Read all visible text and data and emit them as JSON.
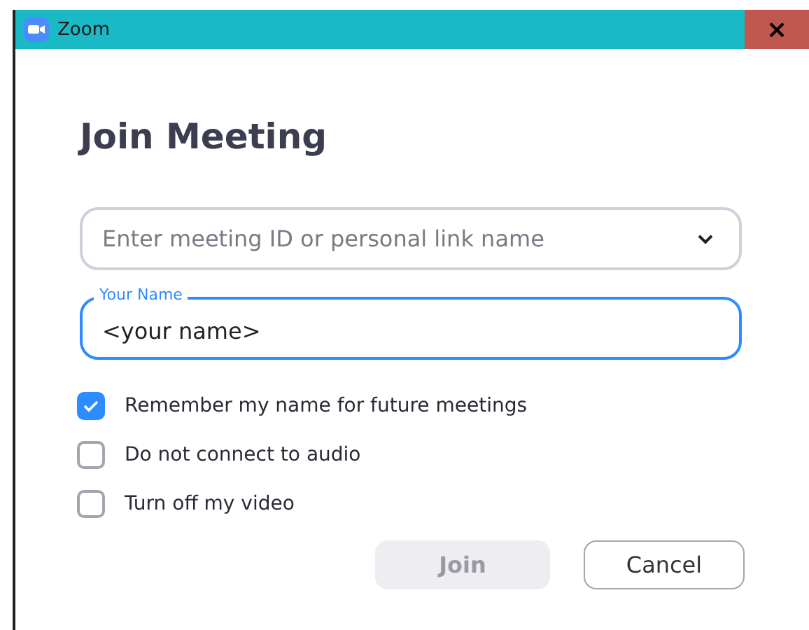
{
  "window": {
    "title": "Zoom",
    "close": "×"
  },
  "heading": "Join Meeting",
  "meeting_field": {
    "placeholder": "Enter meeting ID or personal link name"
  },
  "name_field": {
    "label": "Your Name",
    "value": "<your name>",
    "focused": true
  },
  "options": [
    {
      "label": "Remember my name for future meetings",
      "checked": true
    },
    {
      "label": "Do not connect to audio",
      "checked": false
    },
    {
      "label": "Turn off my video",
      "checked": false
    }
  ],
  "buttons": [
    {
      "label": "Join",
      "disabled": true
    },
    {
      "label": "Cancel",
      "disabled": false
    }
  ]
}
